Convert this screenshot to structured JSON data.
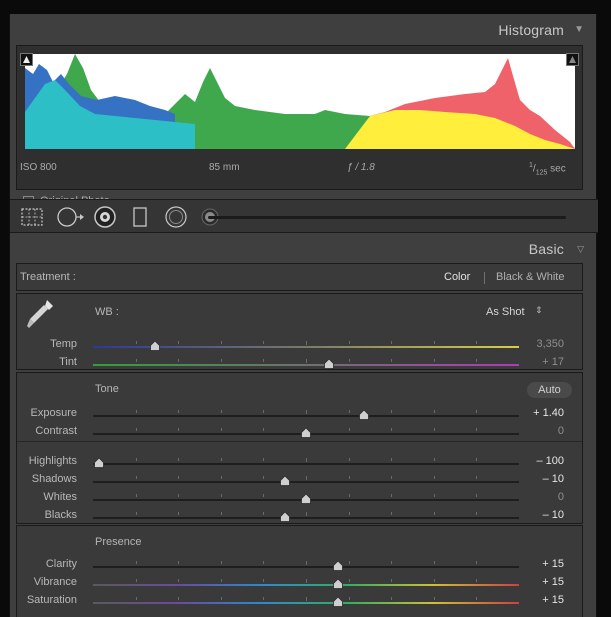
{
  "histogram": {
    "title": "Histogram",
    "iso": "ISO 800",
    "focal_length": "85 mm",
    "aperture": "ƒ / 1.8",
    "shutter_num": "1",
    "shutter_den": "125",
    "shutter_unit": "sec",
    "original_photo_label": "Original Photo"
  },
  "basic": {
    "title": "Basic",
    "treatment_label": "Treatment :",
    "treatment_color": "Color",
    "treatment_bw": "Black & White",
    "wb_label": "WB :",
    "wb_value": "As Shot",
    "tone_label": "Tone",
    "auto_label": "Auto",
    "presence_label": "Presence"
  },
  "sliders": [
    {
      "id": "temp",
      "label": "Temp",
      "value": "3,350",
      "pos": 0.145,
      "active": false,
      "gradient": "temp"
    },
    {
      "id": "tint",
      "label": "Tint",
      "value": "+ 17",
      "pos": 0.555,
      "active": false,
      "gradient": "tint"
    },
    {
      "id": "exposure",
      "label": "Exposure",
      "value": "+ 1.40",
      "pos": 0.635,
      "active": true,
      "gradient": "none"
    },
    {
      "id": "contrast",
      "label": "Contrast",
      "value": "0",
      "pos": 0.5,
      "active": false,
      "gradient": "none"
    },
    {
      "id": "highlights",
      "label": "Highlights",
      "value": "– 100",
      "pos": 0.013,
      "active": true,
      "gradient": "none"
    },
    {
      "id": "shadows",
      "label": "Shadows",
      "value": "– 10",
      "pos": 0.45,
      "active": true,
      "gradient": "none"
    },
    {
      "id": "whites",
      "label": "Whites",
      "value": "0",
      "pos": 0.5,
      "active": false,
      "gradient": "none"
    },
    {
      "id": "blacks",
      "label": "Blacks",
      "value": "– 10",
      "pos": 0.45,
      "active": true,
      "gradient": "none"
    },
    {
      "id": "clarity",
      "label": "Clarity",
      "value": "+ 15",
      "pos": 0.575,
      "active": true,
      "gradient": "none"
    },
    {
      "id": "vibrance",
      "label": "Vibrance",
      "value": "+ 15",
      "pos": 0.575,
      "active": true,
      "gradient": "sat"
    },
    {
      "id": "saturation",
      "label": "Saturation",
      "value": "+ 15",
      "pos": 0.575,
      "active": true,
      "gradient": "sat"
    }
  ],
  "colors": {
    "panel": "#3f3f3f",
    "active_value": "#e6e6e6",
    "inactive_value": "#8f8f8f"
  },
  "icons": [
    "eyedropper-icon",
    "crop-overlay-icon",
    "spot-removal-icon",
    "red-eye-icon",
    "graduated-filter-icon",
    "radial-filter-icon",
    "adjustment-brush-icon",
    "clipping-indicator-icon",
    "collapse-triangle-icon",
    "updown-arrow-icon"
  ]
}
